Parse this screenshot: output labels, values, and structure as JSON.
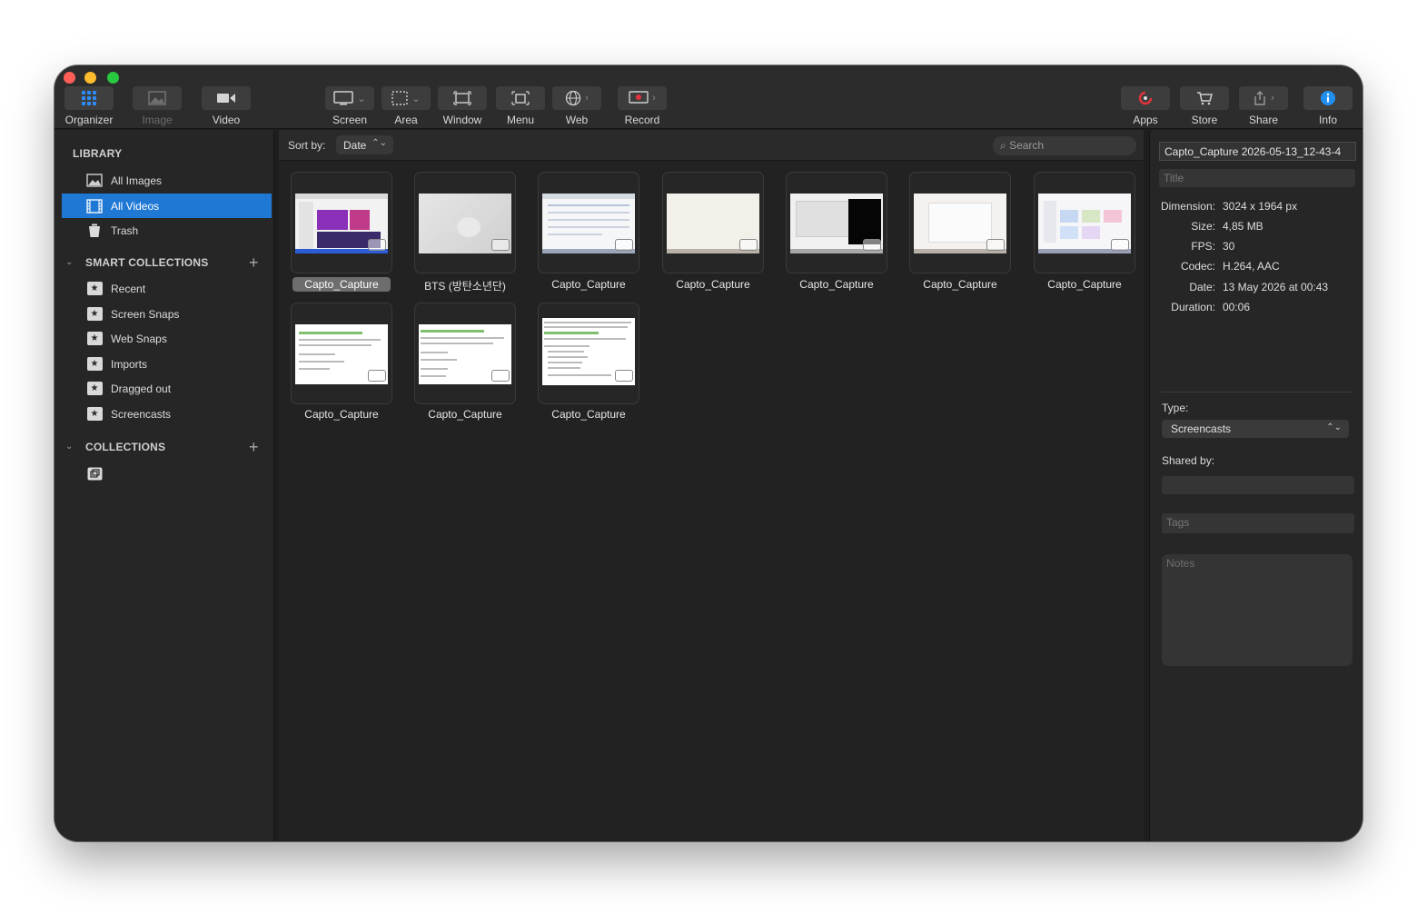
{
  "toolbar": {
    "organizer": "Organizer",
    "image": "Image",
    "video": "Video",
    "screen": "Screen",
    "area": "Area",
    "window": "Window",
    "menu": "Menu",
    "web": "Web",
    "record": "Record",
    "apps": "Apps",
    "store": "Store",
    "share": "Share",
    "info": "Info"
  },
  "sidebar": {
    "library_header": "LIBRARY",
    "library": [
      {
        "label": "All Images",
        "icon": "image-icon"
      },
      {
        "label": "All Videos",
        "icon": "film-icon",
        "selected": true
      },
      {
        "label": "Trash",
        "icon": "trash-icon"
      }
    ],
    "smart_header": "SMART COLLECTIONS",
    "smart": [
      {
        "label": "Recent"
      },
      {
        "label": "Screen Snaps"
      },
      {
        "label": "Web Snaps"
      },
      {
        "label": "Imports"
      },
      {
        "label": "Dragged out"
      },
      {
        "label": "Screencasts"
      }
    ],
    "collections_header": "COLLECTIONS"
  },
  "main": {
    "sort_label": "Sort by:",
    "sort_value": "Date",
    "search_placeholder": "Search",
    "items": [
      {
        "label": "Capto_Capture",
        "selected": true
      },
      {
        "label": "BTS (방탄소년단)"
      },
      {
        "label": "Capto_Capture"
      },
      {
        "label": "Capto_Capture"
      },
      {
        "label": "Capto_Capture"
      },
      {
        "label": "Capto_Capture"
      },
      {
        "label": "Capto_Capture"
      },
      {
        "label": "Capto_Capture"
      },
      {
        "label": "Capto_Capture"
      },
      {
        "label": "Capto_Capture"
      }
    ]
  },
  "inspector": {
    "filename": "Capto_Capture 2026-05-13_12-43-4",
    "title_placeholder": "Title",
    "meta": [
      {
        "key": "Dimension:",
        "value": "3024 x 1964 px"
      },
      {
        "key": "Size:",
        "value": "4,85 MB"
      },
      {
        "key": "FPS:",
        "value": "30"
      },
      {
        "key": "Codec:",
        "value": "H.264, AAC"
      },
      {
        "key": "Date:",
        "value": "13 May 2026 at 00:43"
      },
      {
        "key": "Duration:",
        "value": "00:06"
      }
    ],
    "type_label": "Type:",
    "type_value": "Screencasts",
    "shared_label": "Shared by:",
    "tags_placeholder": "Tags",
    "notes_placeholder": "Notes"
  },
  "colors": {
    "accent": "#1e78d4",
    "window_bg": "#1e1e1e",
    "toolbar_bg": "#2c2c2c",
    "record_red": "#e5323a",
    "info_blue": "#1f8ff0"
  }
}
